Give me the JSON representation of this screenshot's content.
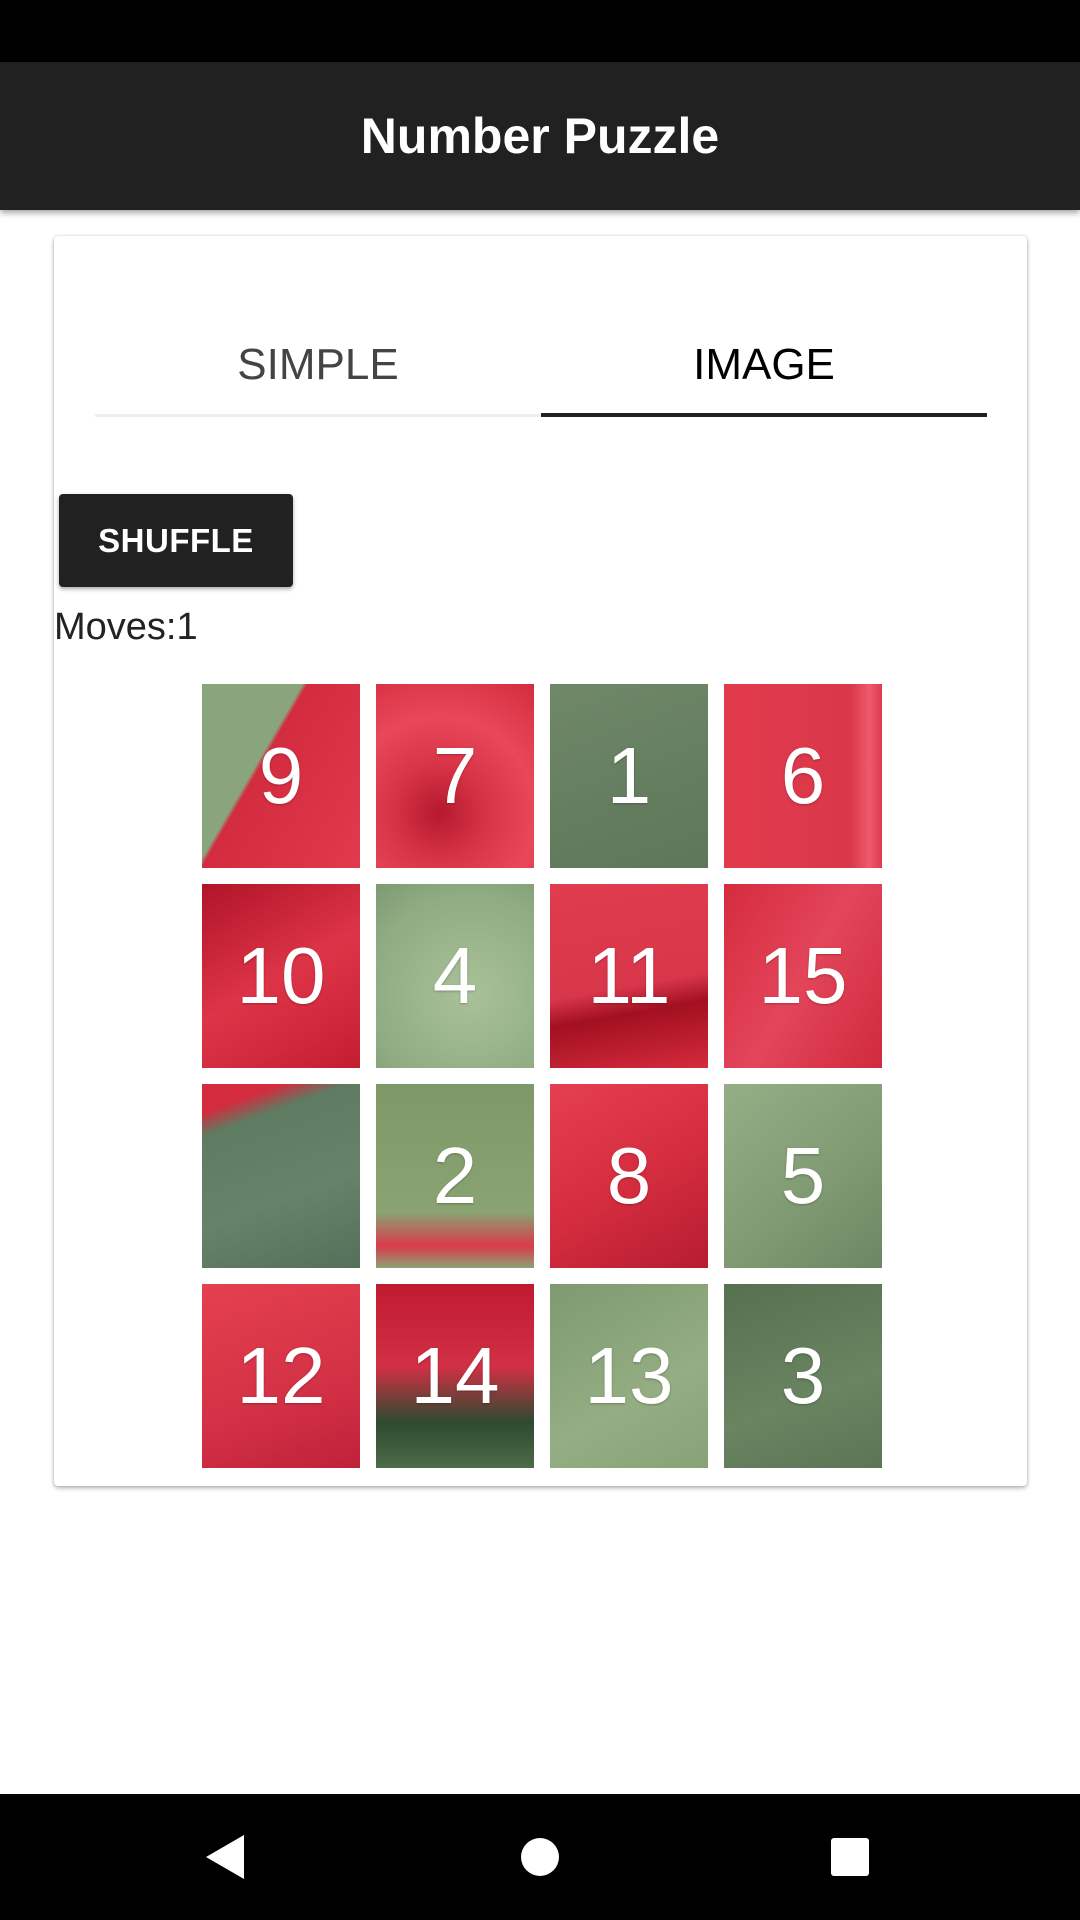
{
  "app": {
    "title": "Number Puzzle"
  },
  "tabs": [
    {
      "label": "SIMPLE",
      "selected": false
    },
    {
      "label": "IMAGE",
      "selected": true
    }
  ],
  "controls": {
    "shuffle_label": "SHUFFLE",
    "moves_text": "Moves:1"
  },
  "grid": {
    "rows": 4,
    "cols": 4,
    "tiles": [
      {
        "label": "9",
        "bg": "linear-gradient(120deg,#8aa57e 0%,#8aa57e 38%,#d42c3f 40%,#e03a4c 100%)"
      },
      {
        "label": "7",
        "bg": "radial-gradient(circle at 40% 70%,#b5192c 0%,#d83447 30%,#e8485a 60%,#d32c3e 100%)"
      },
      {
        "label": "1",
        "bg": "linear-gradient(160deg,#6f8868,#5e7659)"
      },
      {
        "label": "6",
        "bg": "linear-gradient(90deg,#e23a4d 0%,#d9384a 80%,#ee5a6c 92%,#e03a4c 100%)"
      },
      {
        "label": "10",
        "bg": "linear-gradient(150deg,#b11428,#dd3448 50%,#c41d31)"
      },
      {
        "label": "4",
        "bg": "radial-gradient(circle at 60% 60%,#a9c198,#8fab82 70%,#7d9a72)"
      },
      {
        "label": "11",
        "bg": "linear-gradient(170deg,#e03c4e 0%,#d8364a 55%,#a2101f 68%,#d42b3e 100%)"
      },
      {
        "label": "15",
        "bg": "linear-gradient(120deg,#d62b3e 0%,#e3455a 50%,#d02a3d 100%)"
      },
      {
        "label": "",
        "bg": "linear-gradient(160deg,#d42b3e 0%,#d42b3e 12%,#5f7b62 22%,#668268 60%,#55705a 100%)"
      },
      {
        "label": "2",
        "bg": "linear-gradient(180deg,#7f9868 0%,#8aa373 70%,#d93a4a 88%,#8aa373 100%)"
      },
      {
        "label": "8",
        "bg": "linear-gradient(150deg,#e5404f,#d62e40 50%,#b71c30)"
      },
      {
        "label": "5",
        "bg": "linear-gradient(140deg,#94ae86,#7f9a72 60%,#6b8662)"
      },
      {
        "label": "12",
        "bg": "linear-gradient(160deg,#e4404f,#d33145 60%,#c0213a)"
      },
      {
        "label": "14",
        "bg": "linear-gradient(180deg,#c01a30 0%,#d13045 45%,#2e4a30 75%,#4c6b48 100%)"
      },
      {
        "label": "13",
        "bg": "linear-gradient(150deg,#7f9a70,#94ad82 60%,#88a277)"
      },
      {
        "label": "3",
        "bg": "linear-gradient(160deg,#56714f,#6a8462 60%,#5b7654)"
      }
    ]
  },
  "nav": {
    "back_icon": "back-triangle-icon",
    "home_icon": "home-circle-icon",
    "recents_icon": "recents-square-icon"
  }
}
